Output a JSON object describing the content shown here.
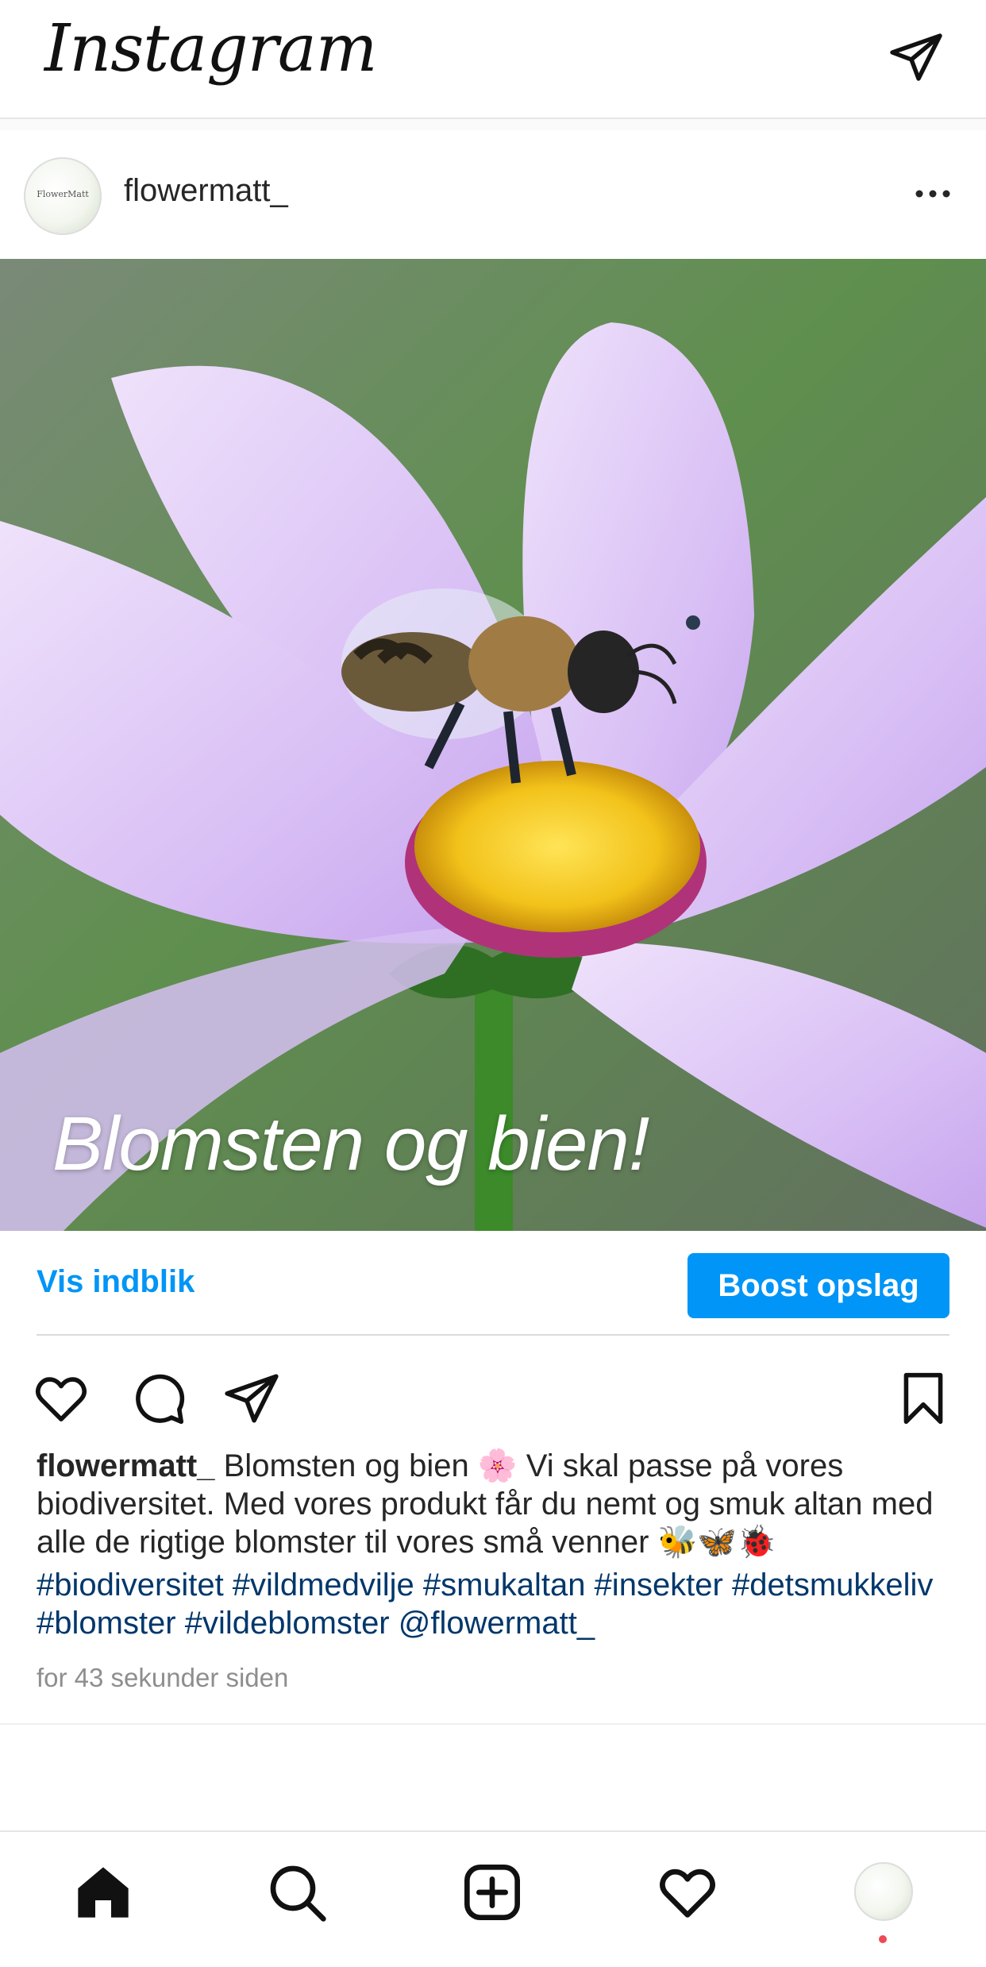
{
  "app": {
    "logo_text": "Instagram"
  },
  "post": {
    "username": "flowermatt_",
    "avatar_text": "FlowerMatt",
    "image_overlay_text": "Blomsten og bien!",
    "insights_label": "Vis indblik",
    "boost_label": "Boost opslag",
    "caption_user": "flowermatt_",
    "caption_text": "Blomsten og bien 🌸 Vi skal passe på vores biodiversitet. Med vores produkt får du nemt og smuk altan med alle de rigtige blomster til vores små venner 🐝🦋🐞",
    "hashtags": "#biodiversitet #vildmedvilje #smukaltan #insekter #detsmukkeliv #blomster #vildeblomster @flowermatt_",
    "timestamp": "for 43 sekunder siden"
  },
  "icons": {
    "top_right": "direct-message-icon",
    "post_menu": "more-options-icon",
    "actions": [
      "like-icon",
      "comment-icon",
      "share-icon",
      "save-icon"
    ],
    "bottom_nav": [
      "home-icon",
      "search-icon",
      "create-post-icon",
      "activity-icon",
      "profile-avatar"
    ]
  },
  "colors": {
    "accent": "#0095f6",
    "hashtag": "#00376b",
    "notification_dot": "#ed4956"
  }
}
